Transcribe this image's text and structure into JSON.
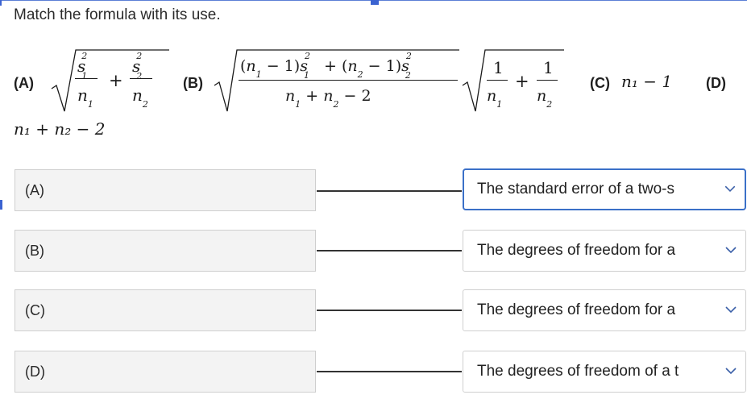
{
  "question": "Match the formula with its use.",
  "formulas": {
    "A": {
      "label": "(A)"
    },
    "B": {
      "label": "(B)"
    },
    "C": {
      "label": "(C)",
      "expr": "n₁ − 1"
    },
    "D": {
      "label": "(D)",
      "expr": "n₁ + n₂ − 2"
    }
  },
  "rows": [
    {
      "term": "(A)",
      "selected": "The standard error of a two-s",
      "focused": true
    },
    {
      "term": "(B)",
      "selected": "The degrees of freedom for a",
      "focused": false
    },
    {
      "term": "(C)",
      "selected": "The degrees of freedom for a",
      "focused": false
    },
    {
      "term": "(D)",
      "selected": "The degrees of freedom of a t",
      "focused": false
    }
  ],
  "icons": {
    "dropdown": "chevron-down-icon"
  },
  "colors": {
    "focus": "#3b70c8",
    "accent": "#3b63d1"
  }
}
